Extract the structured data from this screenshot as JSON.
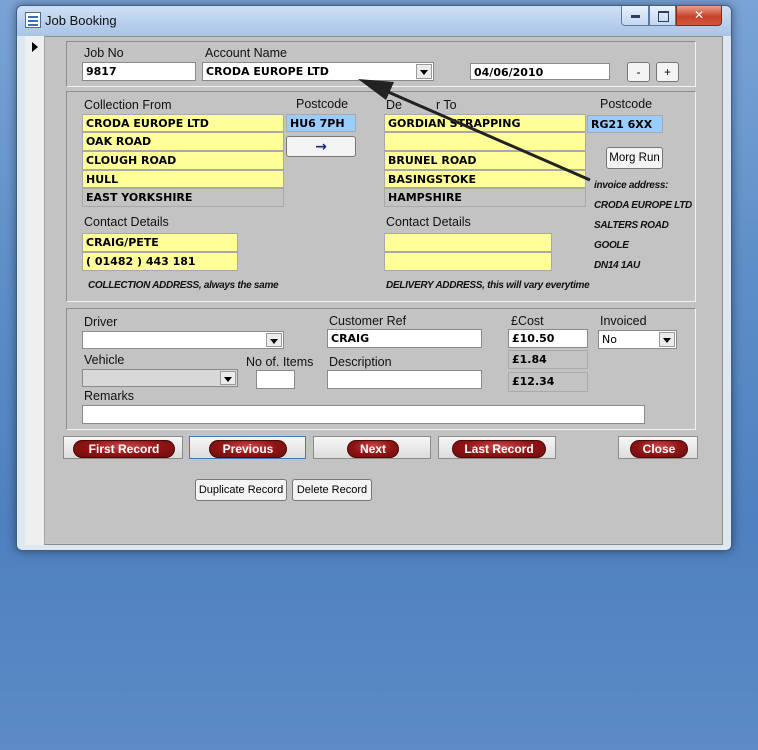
{
  "window": {
    "title": "Job Booking"
  },
  "header": {
    "job_no_label": "Job No",
    "job_no": "9817",
    "account_label": "Account Name",
    "account_name": "CRODA EUROPE LTD",
    "date": "04/06/2010",
    "minus_label": "-",
    "plus_label": "+"
  },
  "collection": {
    "label": "Collection From",
    "postcode_label": "Postcode",
    "lines": [
      "CRODA EUROPE LTD",
      "OAK ROAD",
      "CLOUGH ROAD",
      "HULL",
      "EAST YORKSHIRE"
    ],
    "postcode": "HU6 7PH",
    "copy_arrow": "→",
    "contact_label": "Contact Details",
    "contact_name": "CRAIG/PETE",
    "contact_phone": "( 01482 ) 443 181",
    "note": "COLLECTION ADDRESS, always the same"
  },
  "delivery": {
    "label_start": "De",
    "label_end": "r To",
    "postcode_label": "Postcode",
    "lines": [
      "GORDIAN STRAPPING",
      "",
      "BRUNEL ROAD",
      "BASINGSTOKE",
      "HAMPSHIRE"
    ],
    "postcode": "RG21 6XX",
    "contact_label": "Contact Details",
    "contact_name": "",
    "contact_phone": "",
    "note": "DELIVERY ADDRESS, this will vary everytime",
    "morg_run_label": "Morg Run",
    "invoice_lines": [
      "invoice address:",
      "CRODA EUROPE LTD",
      "SALTERS ROAD",
      "GOOLE",
      "DN14 1AU"
    ]
  },
  "job": {
    "driver_label": "Driver",
    "driver": "",
    "vehicle_label": "Vehicle",
    "vehicle": "",
    "items_label": "No of. Items",
    "items": "",
    "customer_ref_label": "Customer Ref",
    "customer_ref": "CRAIG",
    "description_label": "Description",
    "description": "",
    "cost_label": "£Cost",
    "cost": "£10.50",
    "vat": "£1.84",
    "total": "£12.34",
    "invoiced_label": "Invoiced",
    "invoiced": "No",
    "remarks_label": "Remarks",
    "remarks": ""
  },
  "nav": {
    "first": "First Record",
    "previous": "Previous",
    "next": "Next",
    "last": "Last Record",
    "close": "Close"
  },
  "actions": {
    "duplicate": "Duplicate Record",
    "delete": "Delete Record"
  },
  "colors": {
    "field_yellow": "#ffff99",
    "field_blue": "#99ccff",
    "nav_red": "#8e1414",
    "form_grey": "#c3c3c3"
  }
}
